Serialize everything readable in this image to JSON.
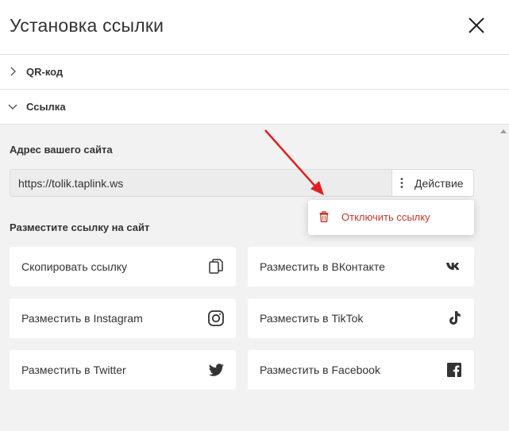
{
  "header": {
    "title": "Установка ссылки"
  },
  "sections": [
    {
      "label": "QR-код",
      "expanded": false
    },
    {
      "label": "Ссылка",
      "expanded": true
    }
  ],
  "site_address": {
    "label": "Адрес вашего сайта",
    "value": "https://tolik.taplink.ws",
    "action_label": "Действие"
  },
  "action_menu": {
    "items": [
      {
        "label": "Отключить ссылку",
        "icon": "trash-icon",
        "color": "#c0392b"
      }
    ]
  },
  "share": {
    "title": "Разместите ссылку на сайт",
    "buttons": [
      {
        "label": "Скопировать ссылку",
        "icon": "copy-icon"
      },
      {
        "label": "Разместить в ВКонтакте",
        "icon": "vk-icon"
      },
      {
        "label": "Разместить в Instagram",
        "icon": "instagram-icon"
      },
      {
        "label": "Разместить в TikTok",
        "icon": "tiktok-icon"
      },
      {
        "label": "Разместить в Twitter",
        "icon": "twitter-icon"
      },
      {
        "label": "Разместить в Facebook",
        "icon": "facebook-icon"
      }
    ]
  },
  "colors": {
    "accent_red": "#c0392b",
    "annotation_arrow": "#e02020",
    "panel_bg": "#f2f2f2"
  }
}
